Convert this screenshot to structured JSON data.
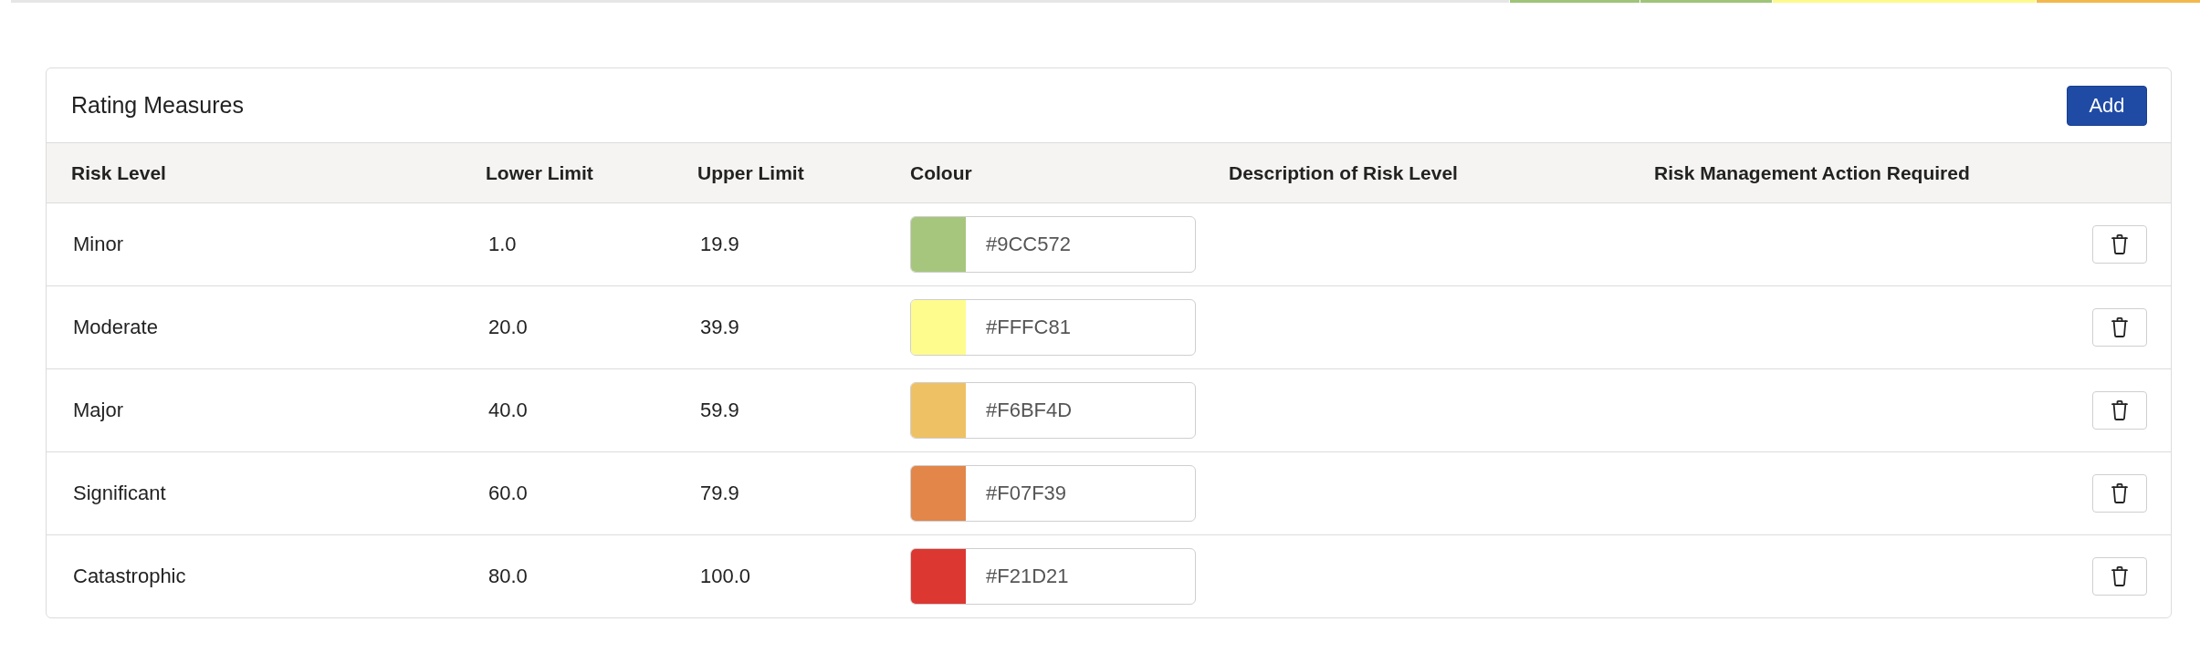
{
  "top_edge_band": [
    {
      "color": "#e6e6e6"
    },
    {
      "color": "#9fc47a"
    },
    {
      "color": "#9fc47a"
    },
    {
      "color": "#fdfa8c"
    },
    {
      "color": "#f2b84e"
    }
  ],
  "panel": {
    "title": "Rating Measures",
    "add_button": "Add"
  },
  "table": {
    "columns": [
      "Risk Level",
      "Lower Limit",
      "Upper Limit",
      "Colour",
      "Description of Risk Level",
      "Risk Management Action Required"
    ],
    "rows": [
      {
        "risk_level": "Minor",
        "lower_limit": "1.0",
        "upper_limit": "19.9",
        "color": "#a7c67d",
        "colour_value": "#9CC572"
      },
      {
        "risk_level": "Moderate",
        "lower_limit": "20.0",
        "upper_limit": "39.9",
        "color": "#fefc8d",
        "colour_value": "#FFFC81"
      },
      {
        "risk_level": "Major",
        "lower_limit": "40.0",
        "upper_limit": "59.9",
        "color": "#eec164",
        "colour_value": "#F6BF4D"
      },
      {
        "risk_level": "Significant",
        "lower_limit": "60.0",
        "upper_limit": "79.9",
        "color": "#e2864a",
        "colour_value": "#F07F39"
      },
      {
        "risk_level": "Catastrophic",
        "lower_limit": "80.0",
        "upper_limit": "100.0",
        "color": "#dc3731",
        "colour_value": "#F21D21"
      }
    ]
  }
}
